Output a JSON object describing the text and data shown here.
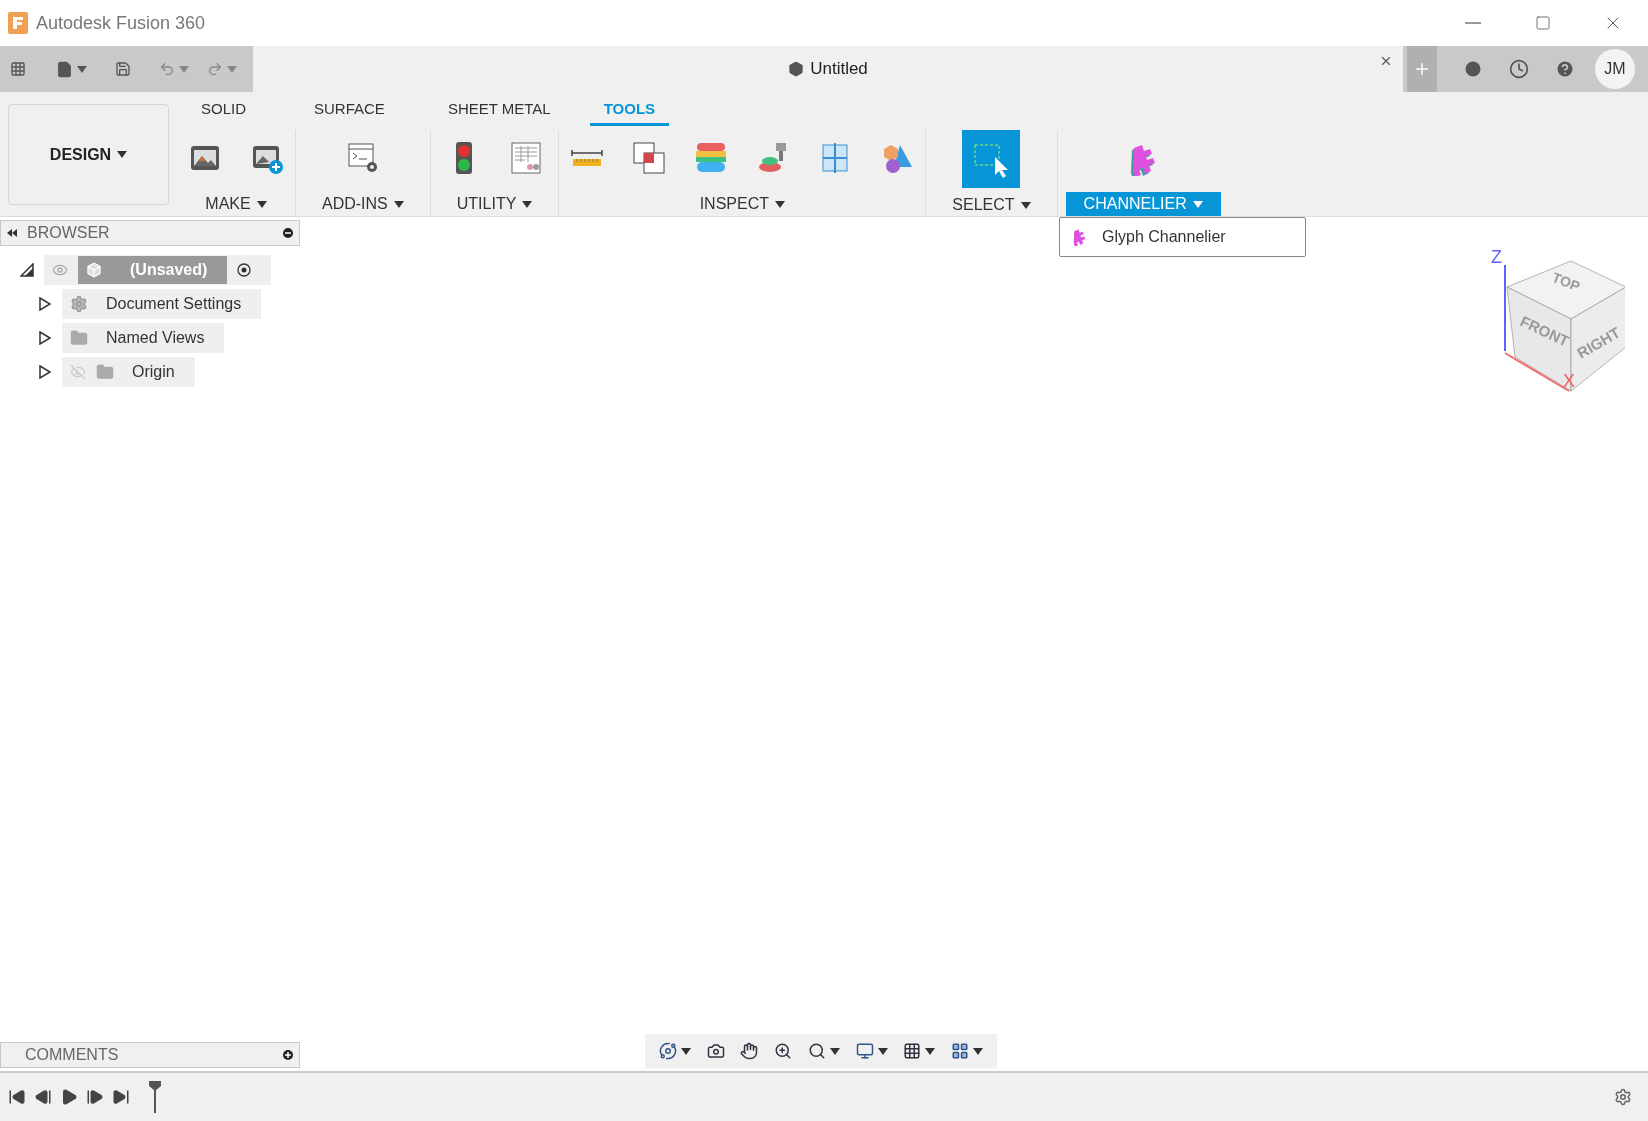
{
  "window": {
    "title": "Autodesk Fusion 360"
  },
  "document_tab": {
    "title": "Untitled"
  },
  "account": {
    "initials": "JM"
  },
  "workspace": {
    "label": "DESIGN"
  },
  "ribbon_tabs": [
    {
      "label": "SOLID",
      "selected": false
    },
    {
      "label": "SURFACE",
      "selected": false
    },
    {
      "label": "SHEET METAL",
      "selected": false
    },
    {
      "label": "TOOLS",
      "selected": true
    }
  ],
  "ribbon_groups": [
    {
      "label": "MAKE",
      "open": false,
      "tools": [
        {
          "kind": "image"
        },
        {
          "kind": "image-add"
        }
      ]
    },
    {
      "label": "ADD-INS",
      "open": false,
      "tools": [
        {
          "kind": "script"
        }
      ]
    },
    {
      "label": "UTILITY",
      "open": false,
      "tools": [
        {
          "kind": "traffic-light"
        },
        {
          "kind": "table"
        }
      ]
    },
    {
      "label": "INSPECT",
      "open": false,
      "tools": [
        {
          "kind": "ruler"
        },
        {
          "kind": "interference"
        },
        {
          "kind": "zebra"
        },
        {
          "kind": "draft"
        },
        {
          "kind": "section"
        },
        {
          "kind": "shapes"
        }
      ]
    },
    {
      "label": "SELECT",
      "open": false,
      "tools": [
        {
          "kind": "window-select",
          "active": true
        }
      ]
    },
    {
      "label": "CHANNELIER",
      "open": true,
      "tools": [
        {
          "kind": "glyph"
        }
      ]
    }
  ],
  "menu": {
    "items": [
      {
        "label": "Glyph Channelier"
      }
    ]
  },
  "browser": {
    "title": "BROWSER",
    "root": {
      "label": "(Unsaved)",
      "expanded": true,
      "visible": true,
      "children": [
        {
          "label": "Document Settings",
          "kind": "settings",
          "expanded": false
        },
        {
          "label": "Named Views",
          "kind": "folder",
          "expanded": false
        },
        {
          "label": "Origin",
          "kind": "folder",
          "expanded": false,
          "visible": false
        }
      ]
    }
  },
  "viewcube": {
    "faces": [
      "TOP",
      "FRONT",
      "RIGHT"
    ],
    "axes": [
      "Z",
      "X"
    ]
  },
  "comments": {
    "title": "COMMENTS"
  }
}
